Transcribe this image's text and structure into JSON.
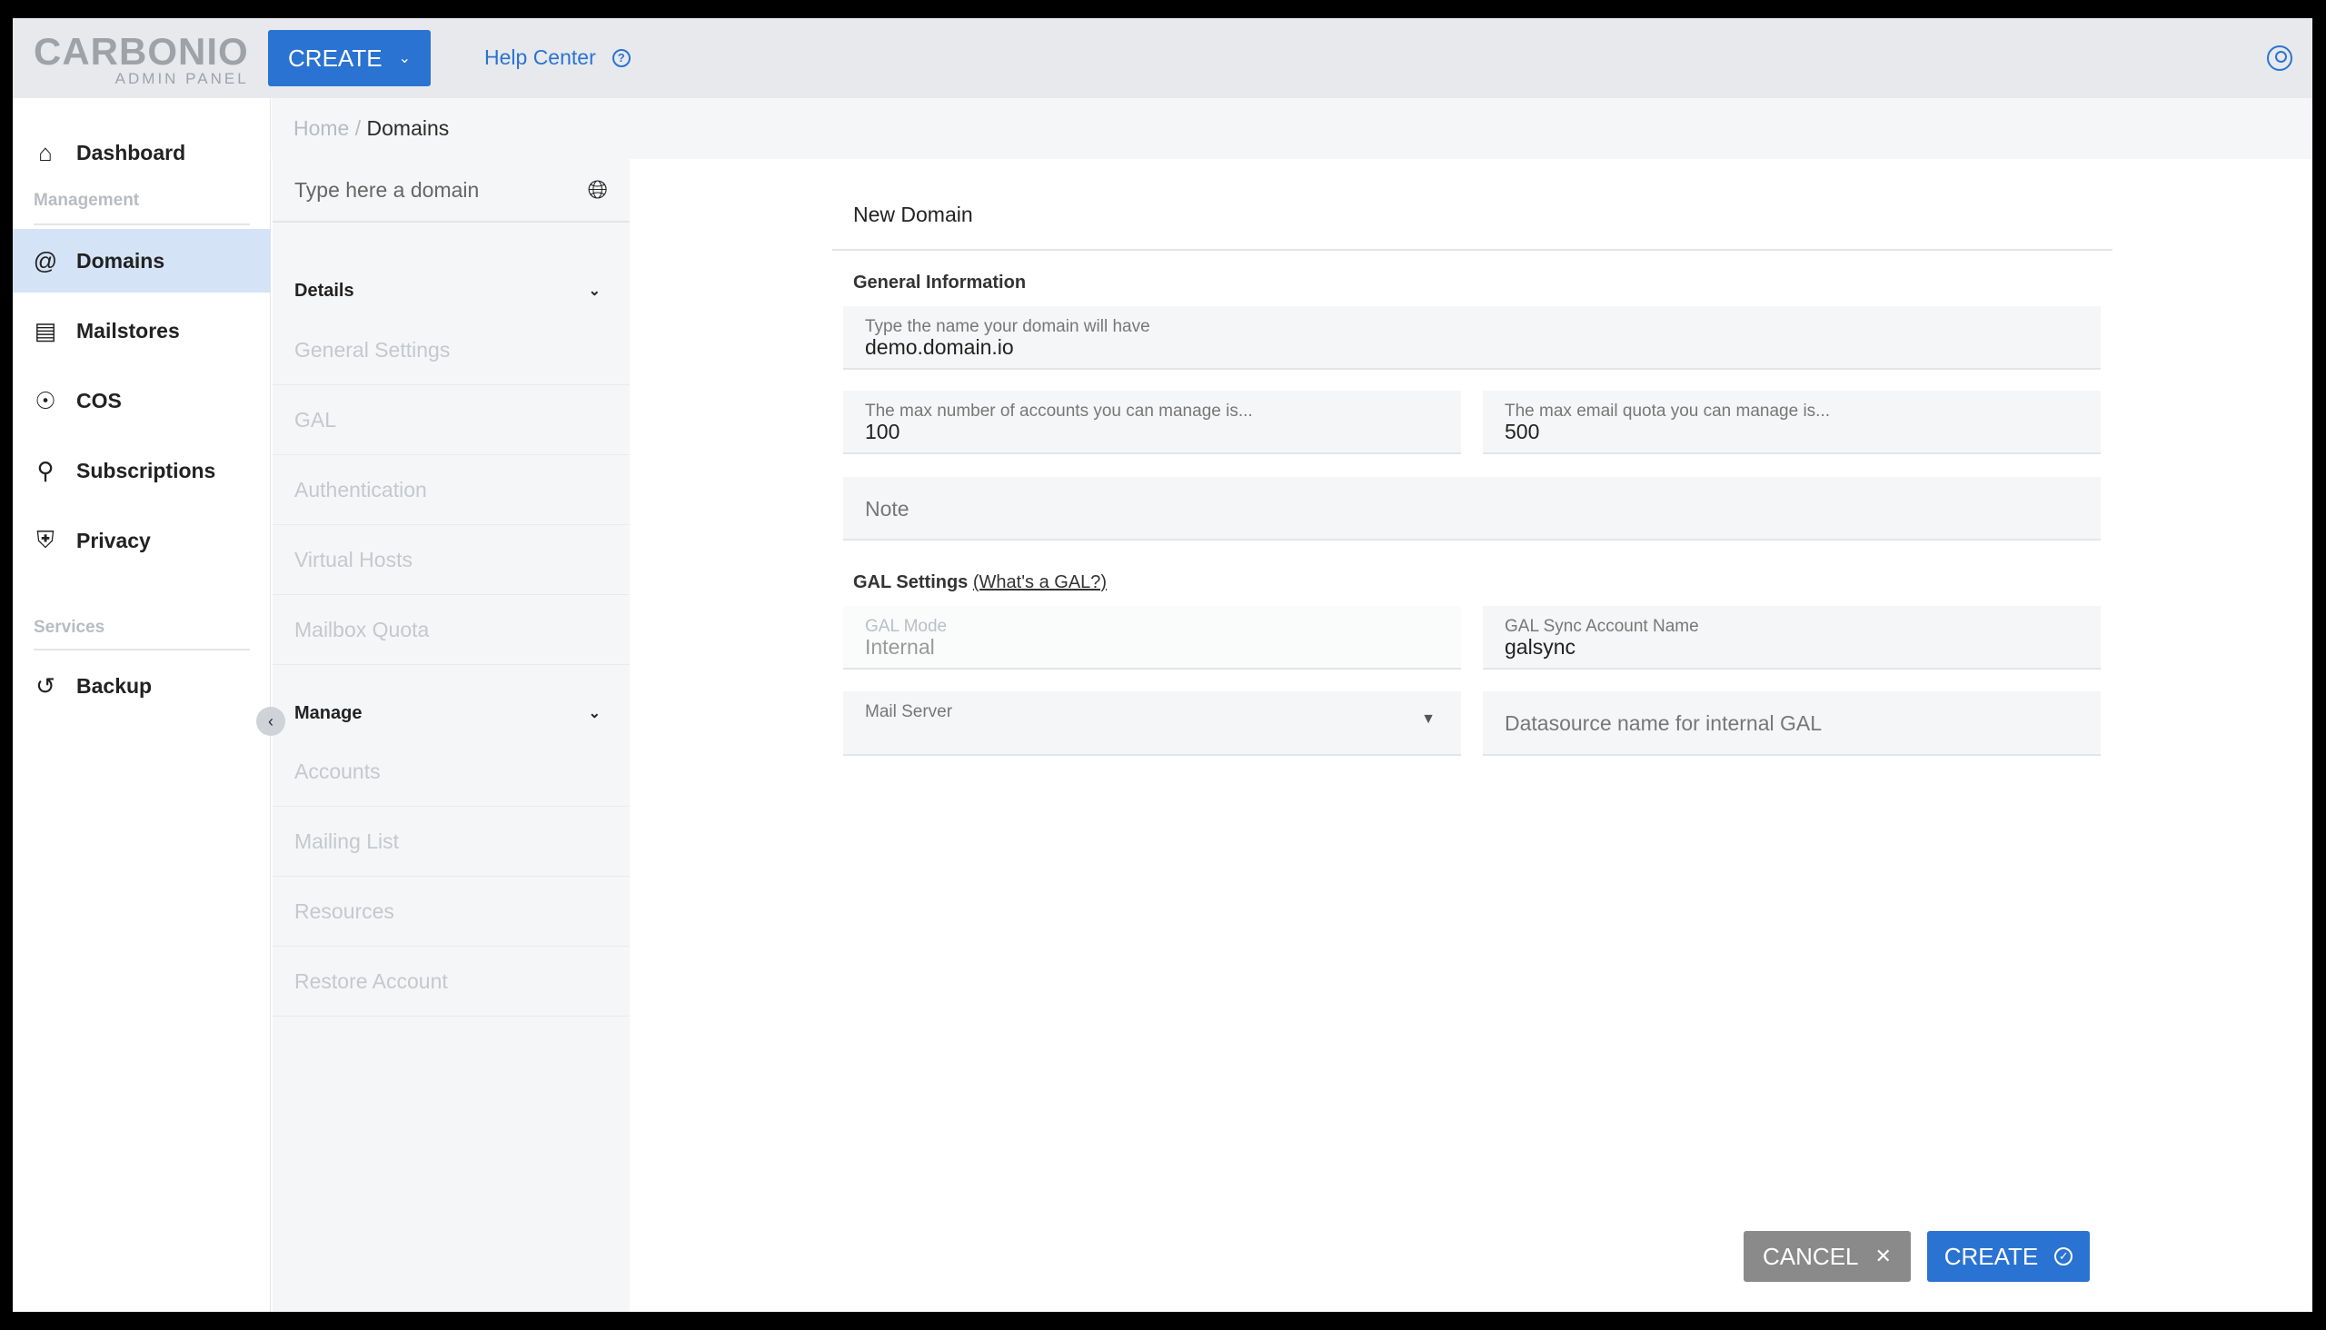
{
  "header": {
    "logo_main": "CARBONIO",
    "logo_sub": "ADMIN PANEL",
    "create_label": "CREATE",
    "help_label": "Help Center"
  },
  "sidebar": {
    "items": [
      {
        "label": "Dashboard",
        "icon": "home-icon"
      },
      {
        "label": "Domains",
        "icon": "at-icon",
        "active": true
      },
      {
        "label": "Mailstores",
        "icon": "storage-icon"
      },
      {
        "label": "COS",
        "icon": "cos-icon"
      },
      {
        "label": "Subscriptions",
        "icon": "award-icon"
      },
      {
        "label": "Privacy",
        "icon": "shield-icon"
      },
      {
        "label": "Backup",
        "icon": "restore-icon"
      }
    ],
    "section_management": "Management",
    "section_services": "Services"
  },
  "breadcrumb": {
    "home": "Home",
    "separator": " / ",
    "current": "Domains"
  },
  "panel": {
    "search_placeholder": "Type here a domain",
    "details_label": "Details",
    "details_items": [
      "General Settings",
      "GAL",
      "Authentication",
      "Virtual Hosts",
      "Mailbox Quota"
    ],
    "manage_label": "Manage",
    "manage_items": [
      "Accounts",
      "Mailing List",
      "Resources",
      "Restore Account"
    ]
  },
  "form": {
    "title": "New Domain",
    "general_heading": "General Information",
    "domain_label": "Type the name your domain will have",
    "domain_value": "demo.domain.io",
    "max_accounts_label": "The max number of accounts you can manage is...",
    "max_accounts_value": "100",
    "max_quota_label": "The max email quota you can manage is...",
    "max_quota_value": "500",
    "note_placeholder": "Note",
    "gal_heading": "GAL Settings",
    "gal_link": "(What's a GAL?)",
    "gal_mode_label": "GAL Mode",
    "gal_mode_value": "Internal",
    "gal_sync_label": "GAL Sync Account Name",
    "gal_sync_value": "galsync",
    "mail_server_label": "Mail Server",
    "datasource_placeholder": "Datasource name for internal GAL"
  },
  "actions": {
    "cancel": "CANCEL",
    "create": "CREATE"
  },
  "colors": {
    "accent": "#2b73d2",
    "cancel": "#8a8a8a",
    "active_nav": "#d5e3f6"
  }
}
